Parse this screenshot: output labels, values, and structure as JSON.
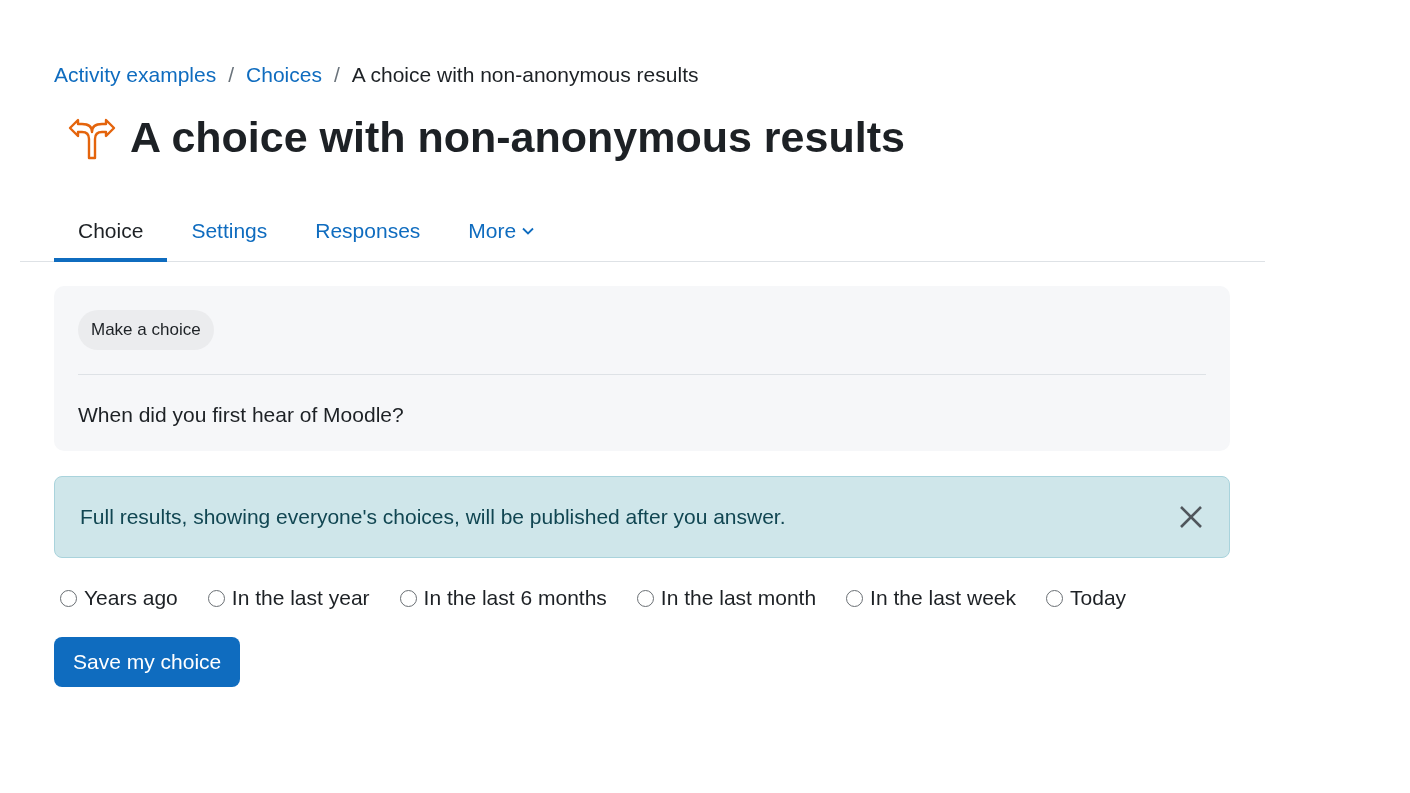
{
  "breadcrumb": [
    {
      "label": "Activity examples",
      "link": true
    },
    {
      "separator": "/",
      "label": "Choices",
      "link": true
    },
    {
      "separator": "/",
      "label": "A choice with non-anonymous results",
      "link": false
    }
  ],
  "title": "A choice with non-anonymous results",
  "tabs": [
    {
      "label": "Choice",
      "selected": true,
      "dropdown": false
    },
    {
      "label": "Settings",
      "selected": false,
      "dropdown": false
    },
    {
      "label": "Responses",
      "selected": false,
      "dropdown": false
    },
    {
      "label": "More",
      "selected": false,
      "dropdown": true
    }
  ],
  "card": {
    "badge": "Make a choice",
    "question": "When did you first hear of Moodle?"
  },
  "alert": {
    "message": "Full results, showing everyone's choices, will be published after you answer."
  },
  "options": [
    {
      "label": "Years ago",
      "selected": false
    },
    {
      "label": "In the last year",
      "selected": false
    },
    {
      "label": "In the last 6 months",
      "selected": false
    },
    {
      "label": "In the last month",
      "selected": false
    },
    {
      "label": "In the last week",
      "selected": false
    },
    {
      "label": "Today",
      "selected": false
    }
  ],
  "submit": "Save my choice"
}
